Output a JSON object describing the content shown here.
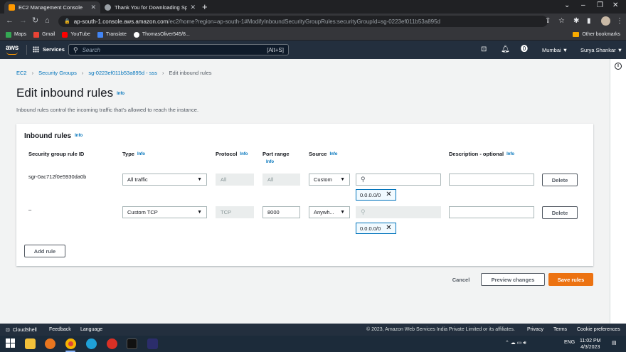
{
  "browser": {
    "tabs": [
      {
        "title": "EC2 Management Console",
        "active": true
      },
      {
        "title": "Thank You for Downloading Splu",
        "active": false
      }
    ],
    "url_host": "ap-south-1.console.aws.amazon.com",
    "url_path": "/ec2/home?region=ap-south-1#ModifyInboundSecurityGroupRules:securityGroupId=sg-0223ef011b53a895d",
    "bookmarks": [
      "Maps",
      "Gmail",
      "YouTube",
      "Translate",
      "ThomasOliver545/8..."
    ],
    "other_bookmarks": "Other bookmarks"
  },
  "aws_header": {
    "logo": "aws",
    "services": "Services",
    "search_placeholder": "Search",
    "search_shortcut": "[Alt+S]",
    "region": "Mumbai ▼",
    "user": "Surya Shankar ▼"
  },
  "breadcrumb": [
    "EC2",
    "Security Groups",
    "sg-0223ef011b53a895d - sss",
    "Edit inbound rules"
  ],
  "page": {
    "title": "Edit inbound rules",
    "info": "Info",
    "description": "Inbound rules control the incoming traffic that's allowed to reach the instance."
  },
  "panel": {
    "title": "Inbound rules",
    "info": "Info",
    "columns": {
      "rule_id": "Security group rule ID",
      "type": "Type",
      "protocol": "Protocol",
      "port_range": "Port range",
      "source": "Source",
      "description": "Description - optional"
    },
    "rows": [
      {
        "rule_id": "sgr-0ac712f0e5930da0b",
        "type": "All traffic",
        "protocol": "All",
        "port": "All",
        "source": "Custom",
        "cidr": "0.0.0.0/0",
        "delete": "Delete"
      },
      {
        "rule_id": "–",
        "type": "Custom TCP",
        "protocol": "TCP",
        "port": "8000",
        "source": "Anywh...",
        "cidr": "0.0.0.0/0",
        "delete": "Delete"
      }
    ],
    "add_rule": "Add rule"
  },
  "actions": {
    "cancel": "Cancel",
    "preview": "Preview changes",
    "save": "Save rules"
  },
  "footer": {
    "cloudshell": "CloudShell",
    "feedback": "Feedback",
    "language": "Language",
    "copyright": "© 2023, Amazon Web Services India Private Limited or its affiliates.",
    "privacy": "Privacy",
    "terms": "Terms",
    "cookies": "Cookie preferences"
  },
  "taskbar": {
    "lang": "ENG",
    "time": "11:02 PM",
    "date": "4/3/2023"
  },
  "colors": {
    "aws_dark": "#232f3e",
    "link": "#0073bb",
    "primary": "#ec7211"
  }
}
